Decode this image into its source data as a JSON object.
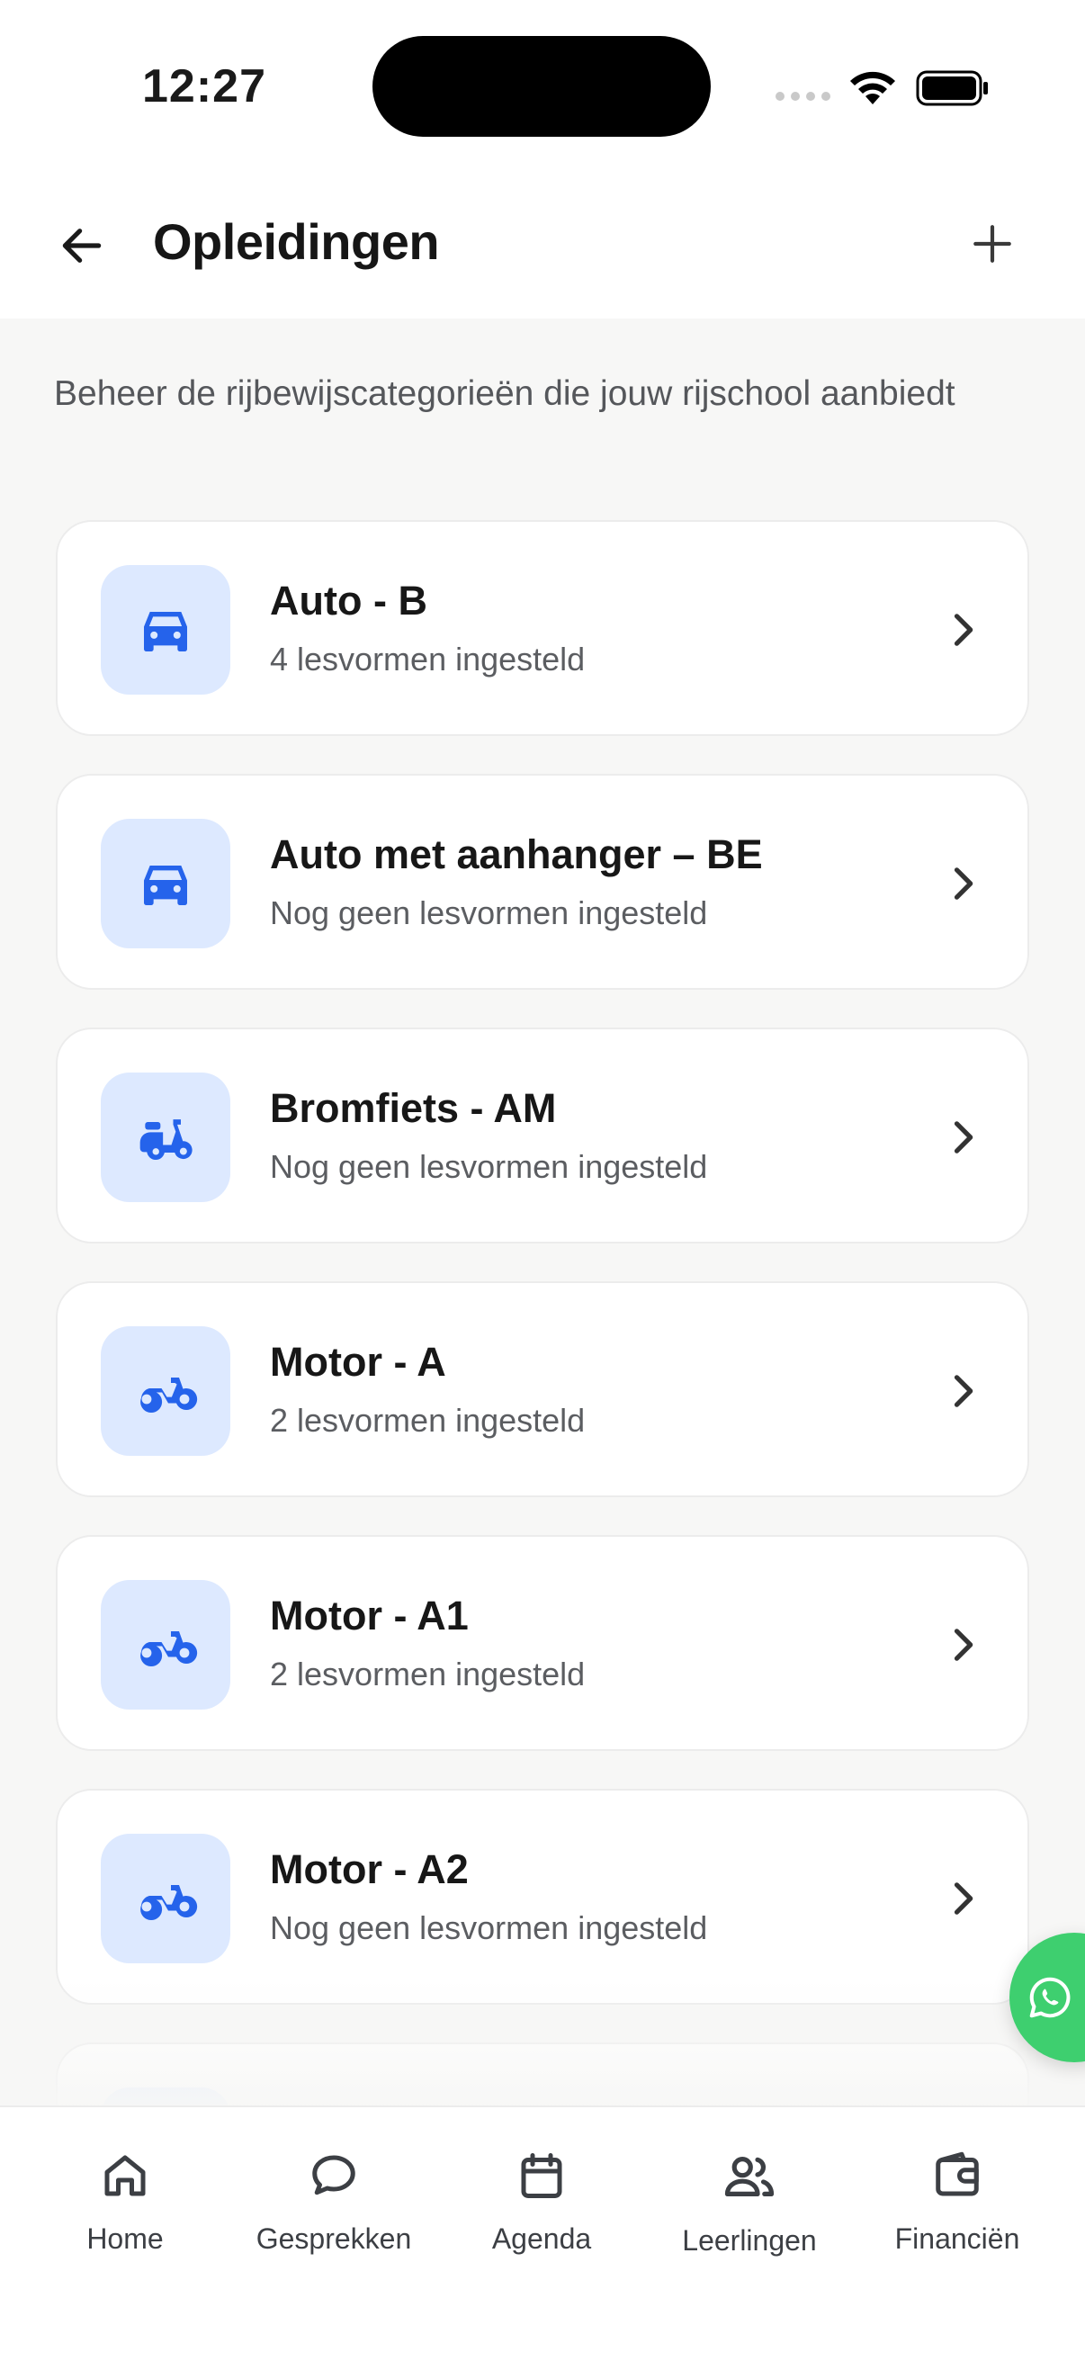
{
  "status_bar": {
    "time": "12:27"
  },
  "header": {
    "title": "Opleidingen"
  },
  "intro": "Beheer de rijbewijscategorieën die jouw rijschool aanbiedt",
  "colors": {
    "accent": "#2563eb",
    "icon_bg": "#dde9ff",
    "whatsapp": "#3ecf6f"
  },
  "categories": [
    {
      "title": "Auto - B",
      "subtitle": "4 lesvormen ingesteld",
      "icon": "car-icon"
    },
    {
      "title": "Auto met aanhanger – BE",
      "subtitle": "Nog geen lesvormen ingesteld",
      "icon": "car-icon"
    },
    {
      "title": "Bromfiets - AM",
      "subtitle": "Nog geen lesvormen ingesteld",
      "icon": "scooter-icon"
    },
    {
      "title": "Motor - A",
      "subtitle": "2 lesvormen ingesteld",
      "icon": "motorcycle-icon"
    },
    {
      "title": "Motor - A1",
      "subtitle": "2 lesvormen ingesteld",
      "icon": "motorcycle-icon"
    },
    {
      "title": "Motor - A2",
      "subtitle": "Nog geen lesvormen ingesteld",
      "icon": "motorcycle-icon"
    }
  ],
  "tabbar": {
    "items": [
      {
        "label": "Home",
        "icon": "home-icon"
      },
      {
        "label": "Gesprekken",
        "icon": "chat-bubble-icon"
      },
      {
        "label": "Agenda",
        "icon": "calendar-icon"
      },
      {
        "label": "Leerlingen",
        "icon": "users-icon"
      },
      {
        "label": "Financiën",
        "icon": "wallet-icon"
      }
    ]
  }
}
